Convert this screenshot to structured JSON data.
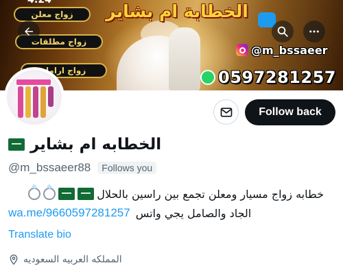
{
  "status_bar": {
    "time": "4:24"
  },
  "header": {
    "back_icon": "arrow-left-icon",
    "search_icon": "search-icon",
    "more_icon": "more-horizontal-icon"
  },
  "banner": {
    "title": "الخطابة ام بشاير",
    "pills": [
      "زواج معلن",
      "زواج مطلقات",
      "زواج ارامل"
    ],
    "instagram_handle": "@m_bssaeer",
    "whatsapp_number": "0597281257"
  },
  "profile": {
    "display_name": "الخطابه ام بشاير",
    "handle": "@m_bssaeer88",
    "follows_you_label": "Follows you",
    "bio_line_1": "خطابه زواج مسيار ومعلن تجمع بين راسين بالحلال",
    "bio_line_2": "الجاد والصامل يجي واتس",
    "bio_link": "wa.me/9660597281257",
    "translate_label": "Translate bio",
    "location": "المملكه العربيه السعوديه"
  },
  "actions": {
    "message_icon": "mail-icon",
    "follow_back_label": "Follow back"
  },
  "colors": {
    "accent": "#1d9bf0",
    "primary_button": "#0f1419",
    "secondary_text": "#536471",
    "banner_gold": "#ffd23a"
  }
}
